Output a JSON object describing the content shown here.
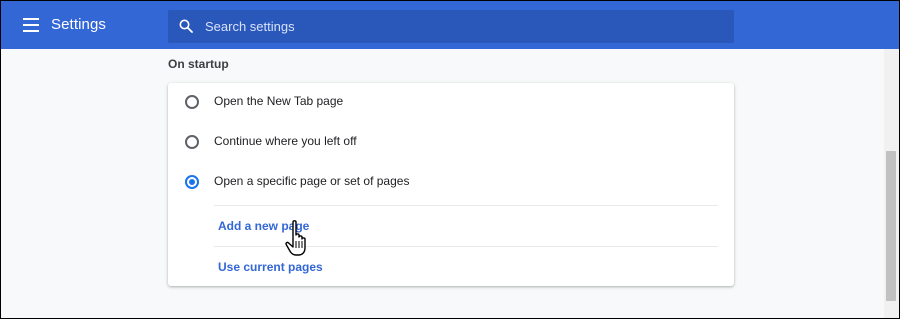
{
  "header": {
    "title": "Settings",
    "search_placeholder": "Search settings"
  },
  "startup": {
    "section_title": "On startup",
    "options": [
      {
        "label": "Open the New Tab page",
        "selected": false
      },
      {
        "label": "Continue where you left off",
        "selected": false
      },
      {
        "label": "Open a specific page or set of pages",
        "selected": true
      }
    ],
    "add_page_link": "Add a new page",
    "use_current_link": "Use current pages"
  },
  "colors": {
    "header_bg": "#3367d6",
    "search_bg": "#2a57ba",
    "accent": "#1a73e8",
    "link": "#3367d6",
    "page_bg": "#f8f9fa"
  },
  "icons": {
    "menu": "hamburger-menu-icon",
    "search": "search-icon",
    "cursor": "hand-pointer-icon"
  }
}
